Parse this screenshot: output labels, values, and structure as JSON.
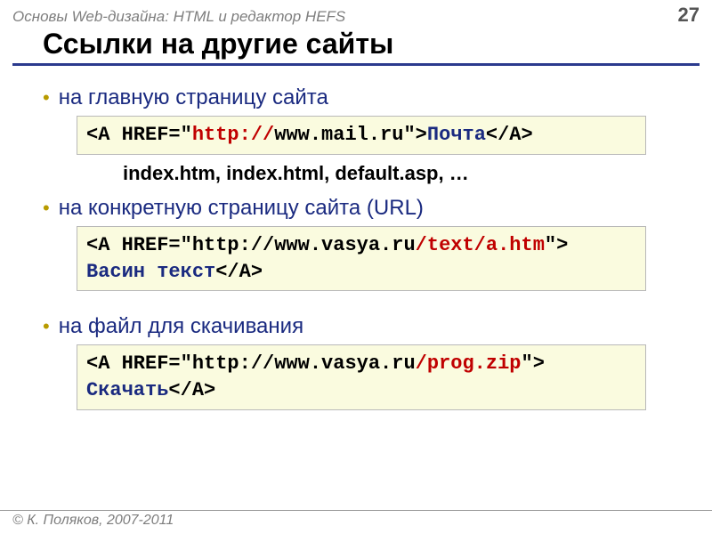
{
  "header": {
    "course": "Основы Web-дизайна: HTML и редактор HEFS",
    "page": "27"
  },
  "title": "Ссылки на другие сайты",
  "bullets": {
    "b1": "на главную страницу сайта",
    "b2": "на конкретную страницу сайта (URL)",
    "b3": "на файл для скачивания"
  },
  "code1": {
    "p1": "<A HREF=\"",
    "proto": "http://",
    "p2": "www.mail.ru\">",
    "link": "Почта",
    "p3": "</A>"
  },
  "note": "index.htm, index.html, default.asp, …",
  "code2": {
    "p1": "<A HREF=\"http://www.vasya.ru",
    "path": "/text/a.htm",
    "p2": "\">",
    "link": "Васин текст",
    "p3": "</A>"
  },
  "code3": {
    "p1": "<A HREF=\"http://www.vasya.ru",
    "path": "/prog.zip",
    "p2": "\">",
    "link": "Скачать",
    "p3": "</A>"
  },
  "footer": "© К. Поляков, 2007-2011"
}
